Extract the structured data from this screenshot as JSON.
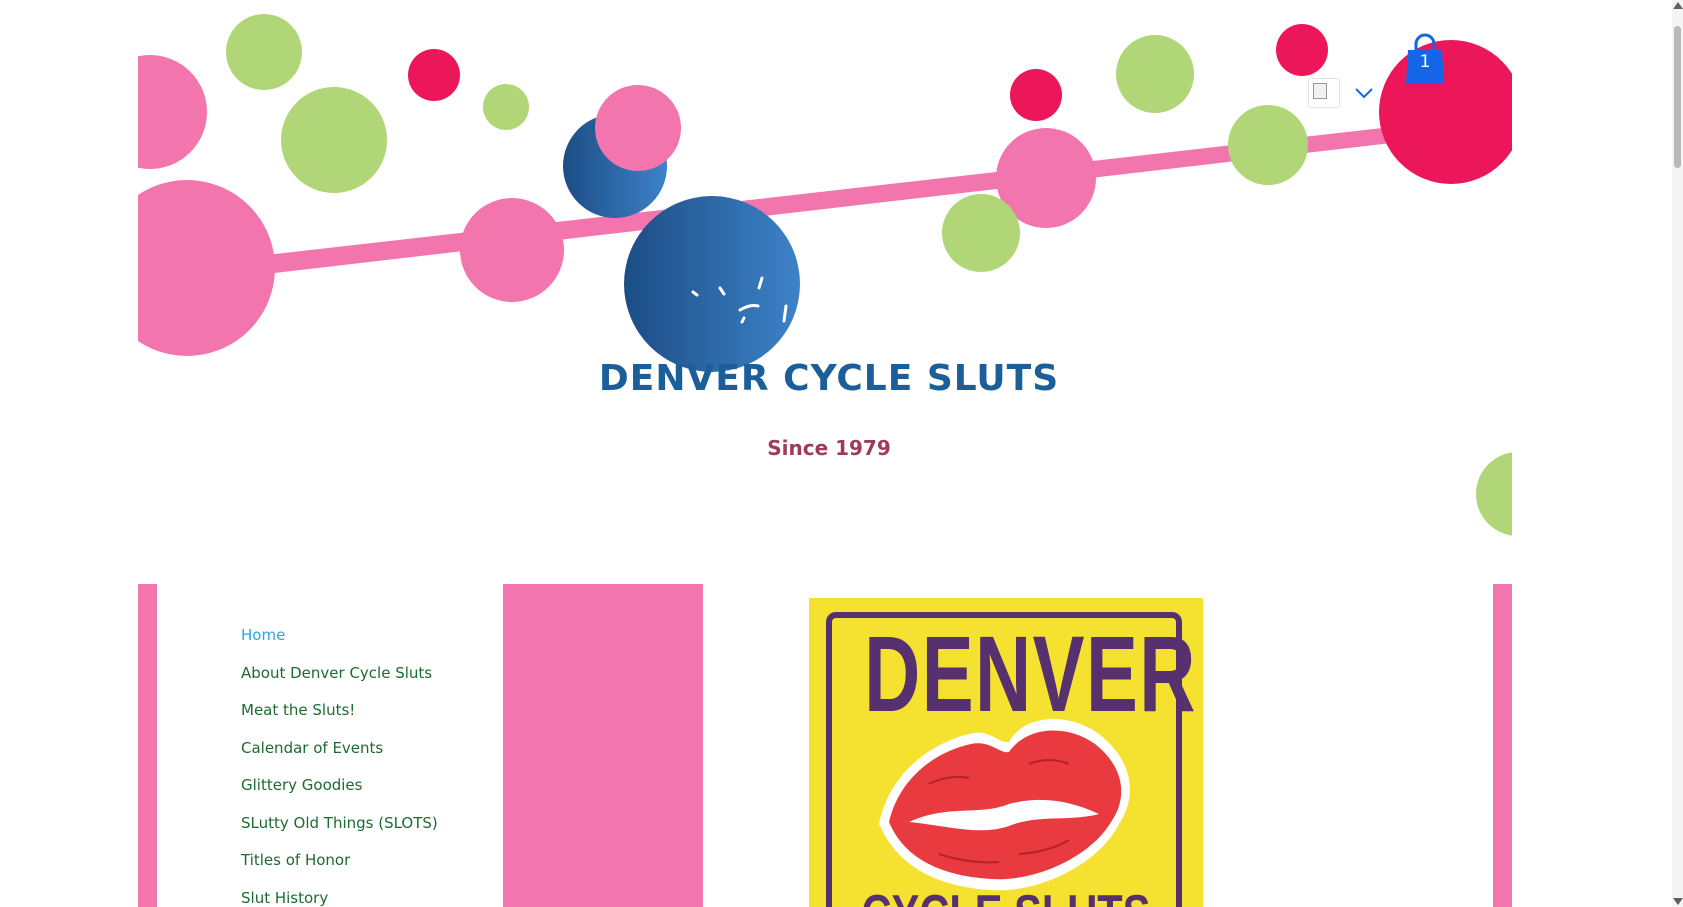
{
  "site": {
    "title": "DENVER CYCLE SLUTS",
    "subtitle": "Since 1979"
  },
  "header": {
    "cart_count": "1",
    "language_flag_icon": "broken-image-icon",
    "language_dropdown_icon": "chevron-down-icon",
    "cart_icon": "shopping-bag-icon"
  },
  "nav": {
    "items": [
      {
        "label": "Home",
        "active": true
      },
      {
        "label": "About Denver Cycle Sluts",
        "active": false
      },
      {
        "label": "Meat the Sluts!",
        "active": false
      },
      {
        "label": "Calendar of Events",
        "active": false
      },
      {
        "label": "Glittery Goodies",
        "active": false
      },
      {
        "label": "SLutty Old Things (SLOTS)",
        "active": false
      },
      {
        "label": "Titles of Honor",
        "active": false
      },
      {
        "label": "Slut History",
        "active": false
      }
    ]
  },
  "logo": {
    "line1": "DENVER",
    "line2": "CYCLE SLUTS",
    "image": "red-lips-icon"
  },
  "colors": {
    "pink": "#f275ae",
    "green": "#b0d678",
    "red": "#ec175b",
    "blue": "#1a5e9a",
    "title": "#1a5e9a",
    "subtitle": "#a03a5c",
    "nav_text": "#1c6b2f",
    "nav_active": "#2aa6df",
    "cart": "#1565e8",
    "logo_yellow": "#f5e12f",
    "logo_purple": "#56306f"
  }
}
